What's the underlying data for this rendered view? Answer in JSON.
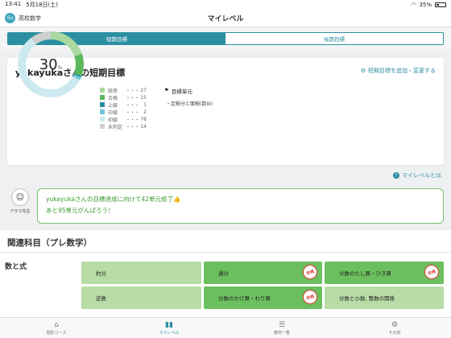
{
  "status": {
    "time": "13:41",
    "date": "5月18日(土)",
    "battery": "35%"
  },
  "header": {
    "subject_avatar": "Su",
    "subject_name": "高校数学",
    "title": "マイレベル"
  },
  "segments": {
    "short_term": "短期目標",
    "long_term": "長期目標"
  },
  "goal": {
    "title": "yukayukaさんの短期目標",
    "add_change": "短期目標を追加・変更する",
    "percent": "30",
    "percent_unit": "%",
    "legend": [
      {
        "label": "既修",
        "dots": "・・・",
        "count": "27",
        "color": "#a9d9a0"
      },
      {
        "label": "合格",
        "dots": "・・・",
        "count": "15",
        "color": "#5cb85c"
      },
      {
        "label": "上級",
        "dots": "・・・",
        "count": "1",
        "color": "#2a8fa0"
      },
      {
        "label": "中級",
        "dots": "・・・",
        "count": "2",
        "color": "#6ec6d4"
      },
      {
        "label": "初級",
        "dots": "・・・",
        "count": "78",
        "color": "#cde9f0"
      },
      {
        "label": "未判定",
        "dots": "・・・",
        "count": "14",
        "color": "#cfcfcf"
      }
    ],
    "unit_heading": "目標単元",
    "unit_items": [
      "・定積分と面積(数III)"
    ]
  },
  "mylevel_link": "マイレベルとは",
  "teacher": {
    "name": "アタマ先生",
    "face": "☺"
  },
  "message": {
    "line1": "yukayukaさんの目標達成に向けて42単元修了👍",
    "line2": "あと95単元がんばろう！"
  },
  "section_title": "関連科目（プレ数学）",
  "topic_group": "数と式",
  "tiles": [
    {
      "label": "約分",
      "stamp": ""
    },
    {
      "label": "通分",
      "stamp": "合格"
    },
    {
      "label": "分数のたし算・ひき算",
      "stamp": "合格"
    },
    {
      "label": "逆数",
      "stamp": ""
    },
    {
      "label": "分数のかけ算・わり算",
      "stamp": "合格"
    },
    {
      "label": "分数と小数, 整数の関係",
      "stamp": ""
    }
  ],
  "tabs": [
    {
      "label": "個別コース",
      "icon": "home-icon"
    },
    {
      "label": "マイレベル",
      "icon": "bar-chart-icon"
    },
    {
      "label": "教材一覧",
      "icon": "list-icon"
    },
    {
      "label": "その他",
      "icon": "gear-icon"
    }
  ]
}
